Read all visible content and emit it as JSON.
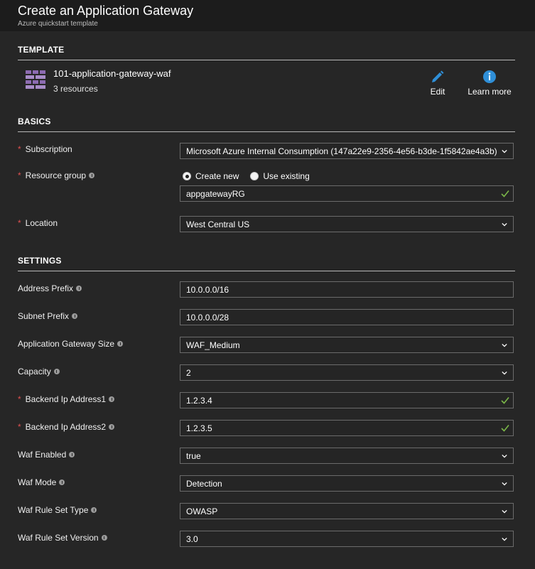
{
  "header": {
    "title": "Create an Application Gateway",
    "subtitle": "Azure quickstart template"
  },
  "template_section": {
    "heading": "TEMPLATE",
    "name": "101-application-gateway-waf",
    "resources": "3 resources",
    "edit_label": "Edit",
    "learn_more_label": "Learn more"
  },
  "basics": {
    "heading": "BASICS",
    "subscription": {
      "label": "Subscription",
      "value": "Microsoft Azure Internal Consumption (147a22e9-2356-4e56-b3de-1f5842ae4a3b)"
    },
    "resource_group": {
      "label": "Resource group",
      "create_new": "Create new",
      "use_existing": "Use existing",
      "selected": "create_new",
      "value": "appgatewayRG"
    },
    "location": {
      "label": "Location",
      "value": "West Central US"
    }
  },
  "settings": {
    "heading": "SETTINGS",
    "address_prefix": {
      "label": "Address Prefix",
      "value": "10.0.0.0/16"
    },
    "subnet_prefix": {
      "label": "Subnet Prefix",
      "value": "10.0.0.0/28"
    },
    "gateway_size": {
      "label": "Application Gateway Size",
      "value": "WAF_Medium"
    },
    "capacity": {
      "label": "Capacity",
      "value": "2"
    },
    "backend_ip1": {
      "label": "Backend Ip Address1",
      "value": "1.2.3.4"
    },
    "backend_ip2": {
      "label": "Backend Ip Address2",
      "value": "1.2.3.5"
    },
    "waf_enabled": {
      "label": "Waf Enabled",
      "value": "true"
    },
    "waf_mode": {
      "label": "Waf Mode",
      "value": "Detection"
    },
    "waf_rule_set_type": {
      "label": "Waf Rule Set Type",
      "value": "OWASP"
    },
    "waf_rule_set_version": {
      "label": "Waf Rule Set Version",
      "value": "3.0"
    }
  },
  "colors": {
    "accent_blue": "#2f8fd8",
    "valid_green": "#7ab648",
    "required_red": "#e05050",
    "template_icon": "#8c6bb1"
  },
  "icons": {
    "template": "template-grid-icon",
    "edit": "pencil-icon",
    "learn_more": "info-circle-icon",
    "dropdown": "chevron-down-icon",
    "valid": "checkmark-icon"
  }
}
